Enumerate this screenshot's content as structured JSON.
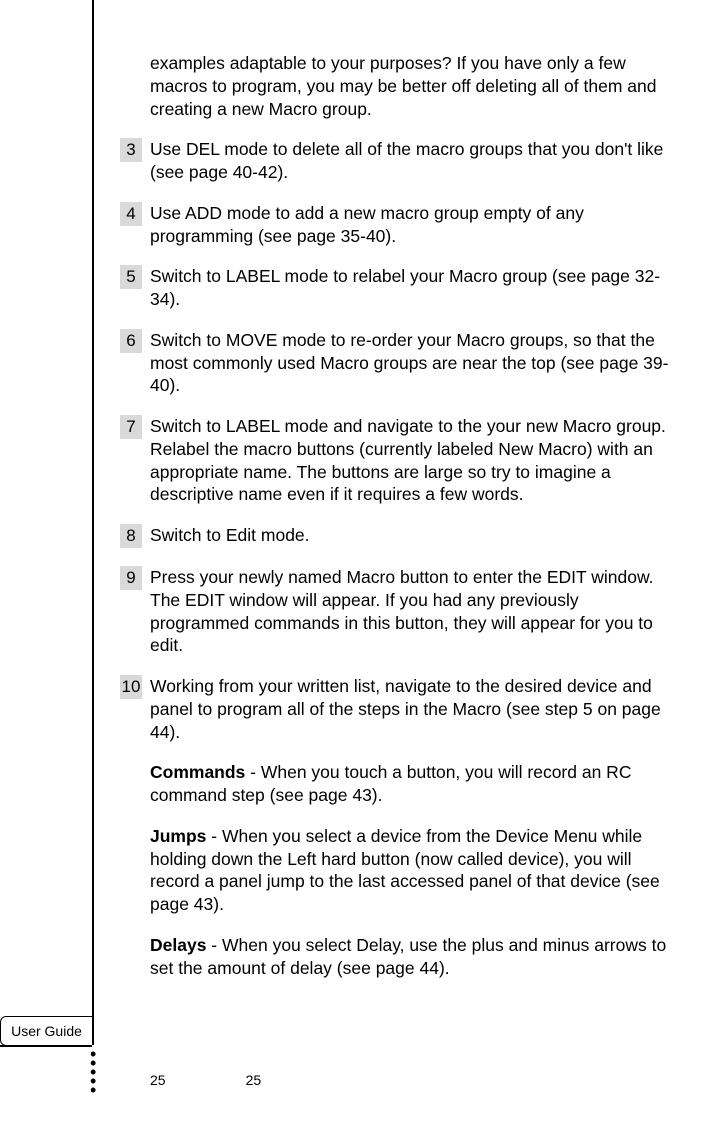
{
  "sidebar_label": "User Guide",
  "intro": "examples adaptable to your purposes?  If you have only a few macros to program, you may be better off deleting all of them and creating a new Macro group.",
  "steps": [
    {
      "n": "3",
      "t": "Use DEL mode to delete all of the macro groups that you don't like (see page 40-42)."
    },
    {
      "n": "4",
      "t": "Use ADD mode to add a new macro group empty of any programming (see page 35-40)."
    },
    {
      "n": "5",
      "t": "Switch to LABEL mode to relabel your Macro group (see page 32-34)."
    },
    {
      "n": "6",
      "t": "Switch to MOVE mode to re-order your Macro groups, so that the most commonly used Macro groups are near the top (see page 39-40)."
    },
    {
      "n": "7",
      "t": "Switch to LABEL mode and navigate to the your new Macro group. Relabel the macro buttons (currently labeled New Macro) with an appropriate name. The buttons are large so try to imagine a descriptive name even if it requires a few words."
    },
    {
      "n": "8",
      "t": "Switch to Edit mode."
    },
    {
      "n": "9",
      "t": "Press your newly named Macro button to enter the EDIT window.\nThe EDIT window will appear. If you had any previously programmed commands in this button, they will appear for you to edit."
    },
    {
      "n": "10",
      "t": "Working from your written list, navigate to the desired device and panel to program all of the steps in the Macro (see step 5 on page 44)."
    }
  ],
  "subs": [
    {
      "lead": "Commands",
      "rest": " - When you touch a button, you will record an RC command step (see page 43)."
    },
    {
      "lead": "Jumps",
      "rest": " - When you select a device from the Device Menu while holding down the Left hard button (now called device), you will record a panel jump to the last accessed panel of that device (see page 43)."
    },
    {
      "lead": "Delays",
      "rest": " - When you select Delay, use the plus and minus arrows to set the amount of delay (see page 44)."
    }
  ],
  "page_numbers": [
    "25",
    "25"
  ]
}
